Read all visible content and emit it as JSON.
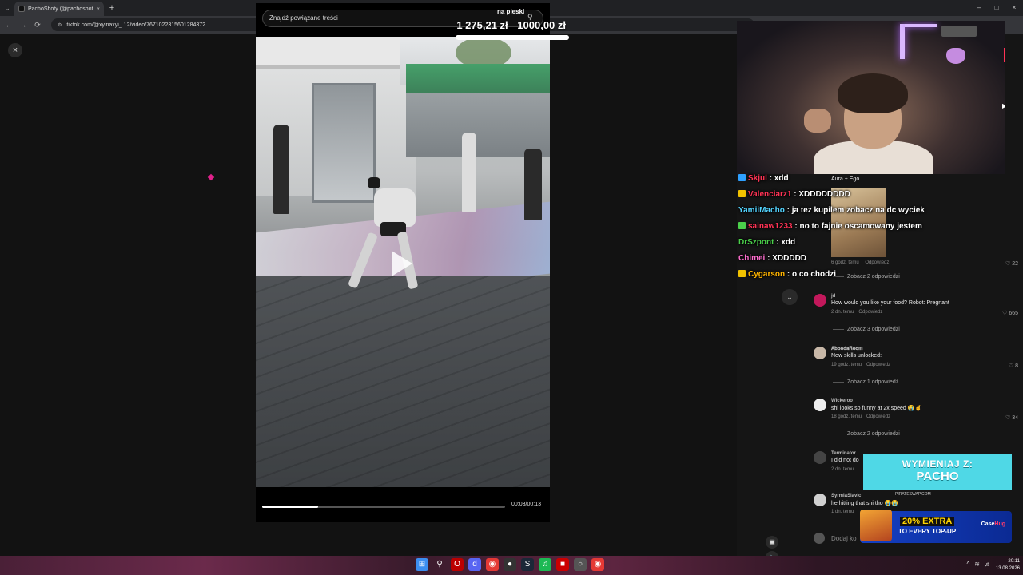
{
  "browser": {
    "tab_title": "PachoShoty (@pachoshoty) | Ti",
    "url": "tiktok.com/@xyinaxyi_.12/video/7671022315601284372",
    "controls": {
      "back": "←",
      "forward": "→",
      "reload": "⟳",
      "new_tab": "+",
      "tab_close": "×",
      "minimize": "–",
      "maximize": "□",
      "close": "×"
    }
  },
  "tiktok": {
    "close_label": "×",
    "search_placeholder": "Znajdź powiązane treści",
    "time": "00:03/00:13",
    "progress_fraction": 0.23
  },
  "donation": {
    "label": "na pleski",
    "current": "1 275,21 zł",
    "goal": "1000,00 zł",
    "progress_fraction": 1.0
  },
  "chat": [
    {
      "user": "Skjul",
      "color": "#ff3355",
      "badge": "#2ea0ff",
      "msg": ": xdd"
    },
    {
      "user": "Valenciarz1",
      "color": "#ff3355",
      "badge": "#f2c200",
      "msg": ": XDDDDDDDD"
    },
    {
      "user": "YamiiMacho",
      "color": "#53d4ff",
      "badge": "",
      "msg": ": ja tez kupilem zobacz na dc wyciek"
    },
    {
      "user": "sainaw1233",
      "color": "#ff3355",
      "badge": "#4bd04b",
      "msg": ": no to fajnie oscamowany jestem"
    },
    {
      "user": "DrSzpont",
      "color": "#4bd04b",
      "badge": "",
      "msg": ": xdd"
    },
    {
      "user": "Chimei",
      "color": "#ff6fcf",
      "badge": "",
      "msg": ": XDDDDD"
    },
    {
      "user": "Cygarson",
      "color": "#ffb400",
      "badge": "#f2c200",
      "msg": ": o co chodzi"
    }
  ],
  "comments": {
    "top_name": "Aura + Ego",
    "first_meta": {
      "time": "6 godz. temu",
      "reply": "Odpowiedz",
      "likes": "22"
    },
    "first_replies": "Zobacz 2 odpowiedzi",
    "items": [
      {
        "user": "jd",
        "text": "How would you like your food? Robot: Pregnant",
        "time": "2 dn. temu",
        "reply": "Odpowiedz",
        "likes": "665",
        "replies": "Zobacz 3 odpowiedzi",
        "avatar": "#c2185b"
      },
      {
        "user": "𝐀𝐛𝐨𝐨𝐝𝐚𝐑𝐨𝐨𝐦",
        "text": "New skills unlocked:",
        "time": "19 godz. temu",
        "reply": "Odpowiedz",
        "likes": "8",
        "replies": "Zobacz 1 odpowiedź",
        "avatar": "#c8b8a8"
      },
      {
        "user": "Wickeroo",
        "text": "shi looks so funny at 2x speed 😭✌️",
        "time": "18 godz. temu",
        "reply": "Odpowiedz",
        "likes": "34",
        "replies": "Zobacz 2 odpowiedzi",
        "avatar": "#eeeeee"
      },
      {
        "user": "Terminator",
        "text": "I did not do",
        "time": "2 dn. temu",
        "reply": "",
        "likes": "",
        "replies": "",
        "avatar": "#444444"
      },
      {
        "user": "SyrmiaSlavic",
        "text": "he hitting that shi tho 😭😭",
        "time": "1 dn. temu",
        "reply": "",
        "likes": "",
        "replies": "",
        "avatar": "#d0d0d0"
      }
    ],
    "add_placeholder": "Dodaj ko"
  },
  "ads": {
    "pacho_line1": "WYMIENIAJ Z:",
    "pacho_line2": "PACHO",
    "pacho_domain": "PIRATESWAP.COM",
    "case_pct": "20% EXTRA",
    "case_sub": "TO EVERY TOP-UP",
    "case_brand_a": "Case",
    "case_brand_b": "Hug"
  },
  "taskbar": {
    "time": "20:11",
    "date": "13.08.2026"
  },
  "colors": {
    "accent_pink": "#e0218a",
    "tiktok_bg": "#121212"
  }
}
